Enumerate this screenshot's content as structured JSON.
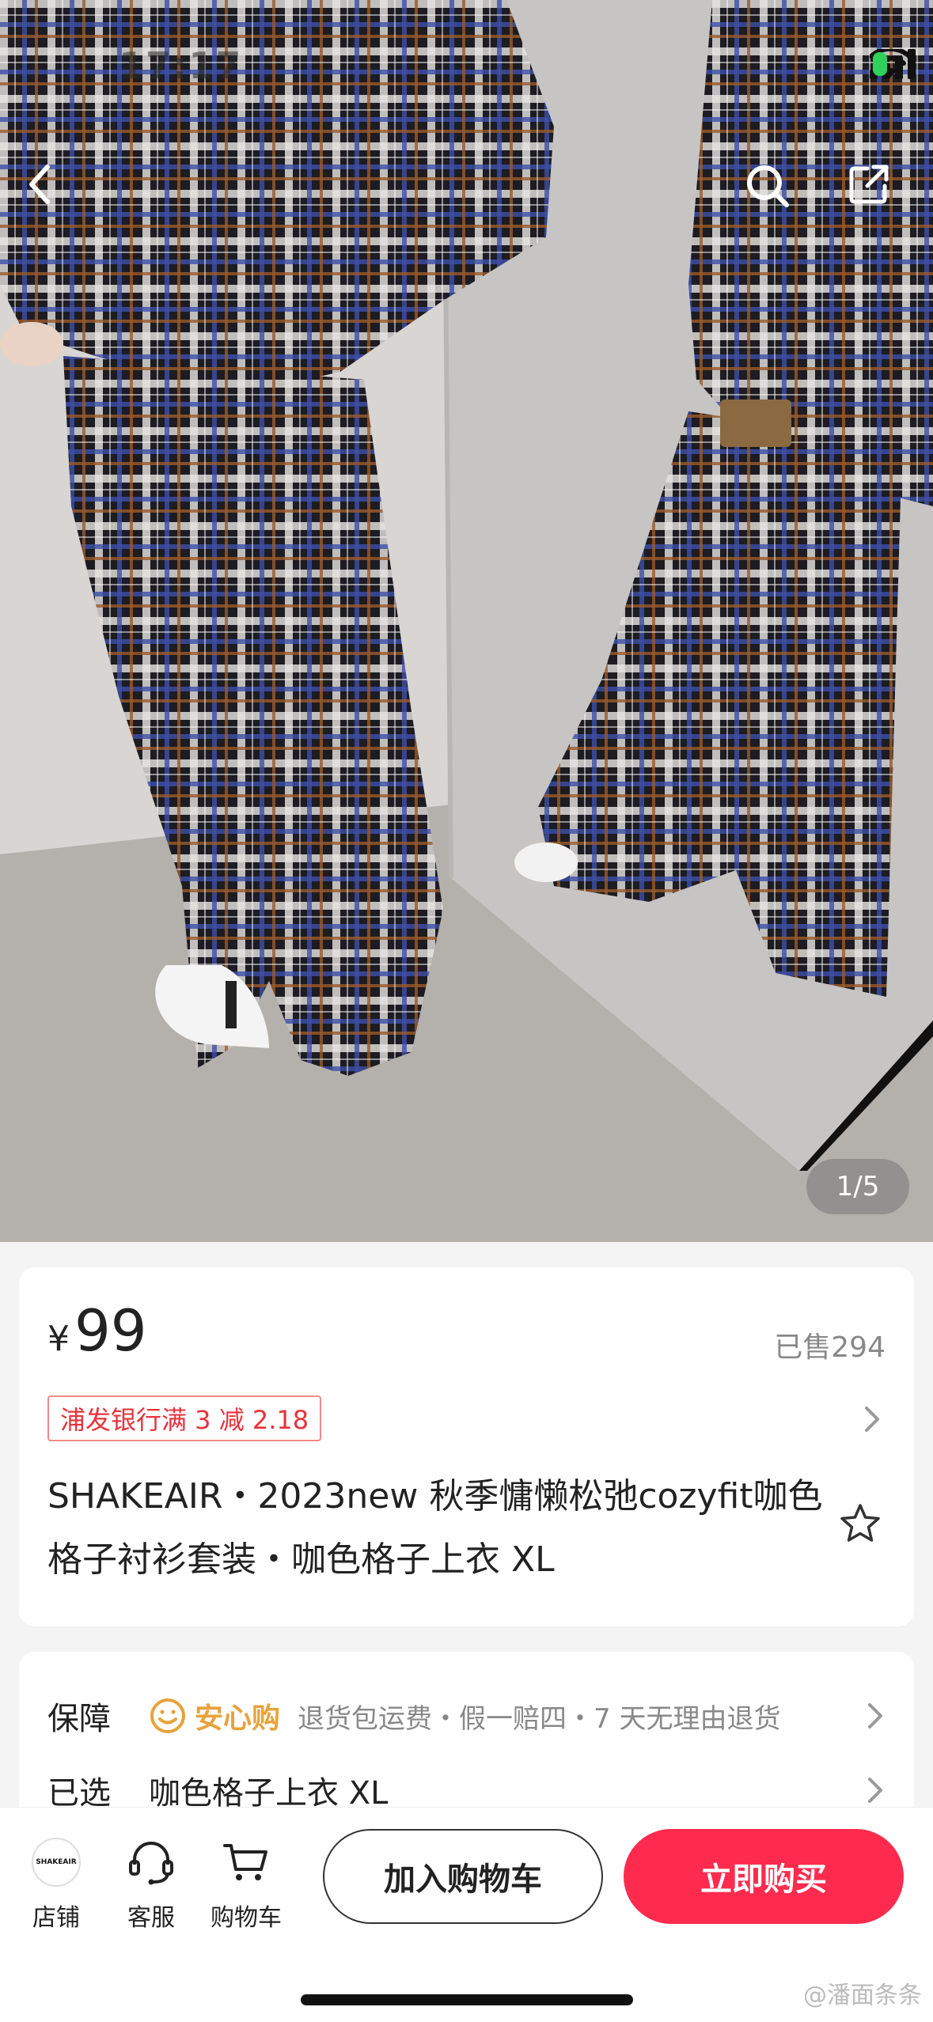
{
  "status": {
    "time": "17:17"
  },
  "gallery": {
    "counter": "1/5"
  },
  "product": {
    "currency": "¥",
    "price": "99",
    "sold": "已售294",
    "promo": "浦发银行满 3 减 2.18",
    "title": "SHAKEAIR・2023new 秋季慵懒松弛cozyfit咖色格子衬衫套装・咖色格子上衣 XL"
  },
  "info": {
    "assurance_label": "保障",
    "assurance_badge": "安心购",
    "assurance_text": "退货包运费・假一赔四・7 天无理由退货",
    "selected_label": "已选",
    "selected_value": "咖色格子上衣 XL"
  },
  "bottom": {
    "store_logo": "SHAKEAIR",
    "store": "店铺",
    "service": "客服",
    "cart": "购物车",
    "add_to_cart": "加入购物车",
    "buy_now": "立即购买"
  },
  "watermark": "@潘面条条",
  "colors": {
    "accent": "#ff2b4e",
    "promo": "#e8323c",
    "assurance": "#e8a23a"
  }
}
